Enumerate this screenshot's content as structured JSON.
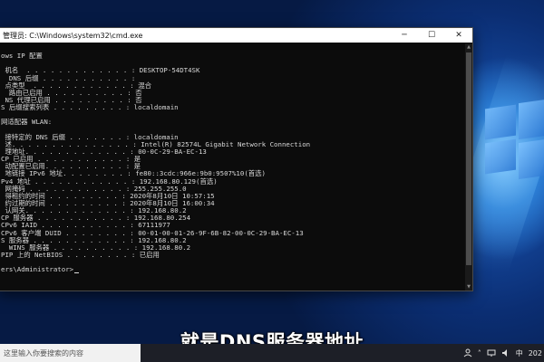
{
  "window": {
    "title": "管理员: C:\\Windows\\system32\\cmd.exe",
    "controls": {
      "minimize": "─",
      "maximize": "☐",
      "close": "✕"
    }
  },
  "console_lines": [
    "",
    "ows IP 配置",
    "",
    " 机名  . . . . . . . . . . . . . : DESKTOP-54DT4SK",
    "  DNS 后缀 . . . . . . . . . . . :",
    " 点类型  . . . . . . . . . . . . : 混合",
    "  路由已启用 . . . . . . . . . . : 否",
    " NS 代理已启用 . . . . . . . . . : 否",
    "S 后缀搜索列表 . . . . . . . . . : localdomain",
    "",
    "网适配器 WLAN:",
    "",
    " 接特定的 DNS 后缀 . . . . . . . : localdomain",
    " 述. . . . . . . . . . . . . . . : Intel(R) 82574L Gigabit Network Connection",
    " 理地址. . . . . . . . . . . . . : 00-0C-29-BA-EC-13",
    "CP 已启用 . . . . . . . . . . . : 是",
    " 动配置已启用. . . . . . . . . . : 是",
    " 地链接 IPv6 地址. . . . . . . . : fe80::3cdc:966e:9b0:9507%10(首选)",
    "Pv4 地址 . . . . . . . . . . . . : 192.168.80.129(首选)",
    " 网掩码 . . . . . . . . . . . . : 255.255.255.0",
    " 得租约的时间 . . . . . . . . . : 2020年8月10日 10:57:15",
    " 约过期的时间 . . . . . . . . . : 2020年8月10日 16:00:34",
    " 认网关. . . . . . . . . . . . . : 192.168.80.2",
    "CP 服务器 . . . . . . . . . . . : 192.168.80.254",
    "CPv6 IAID . . . . . . . . . . . : 67111977",
    "CPv6 客户端 DUID . . . . . . . . : 00-01-00-01-26-9F-6B-82-00-0C-29-BA-EC-13",
    "S 服务器 . . . . . . . . . . . . : 192.168.80.2",
    "  WINS 服务器 . . . . . . . . . . : 192.168.80.2",
    "PIP 上的 NetBIOS . . . . . . . . : 已启用",
    "",
    "ers\\Administrator>"
  ],
  "subtitle": "就是DNS服务器地址",
  "taskbar": {
    "search_placeholder": "这里输入你要搜索的内容",
    "clock": "202"
  }
}
